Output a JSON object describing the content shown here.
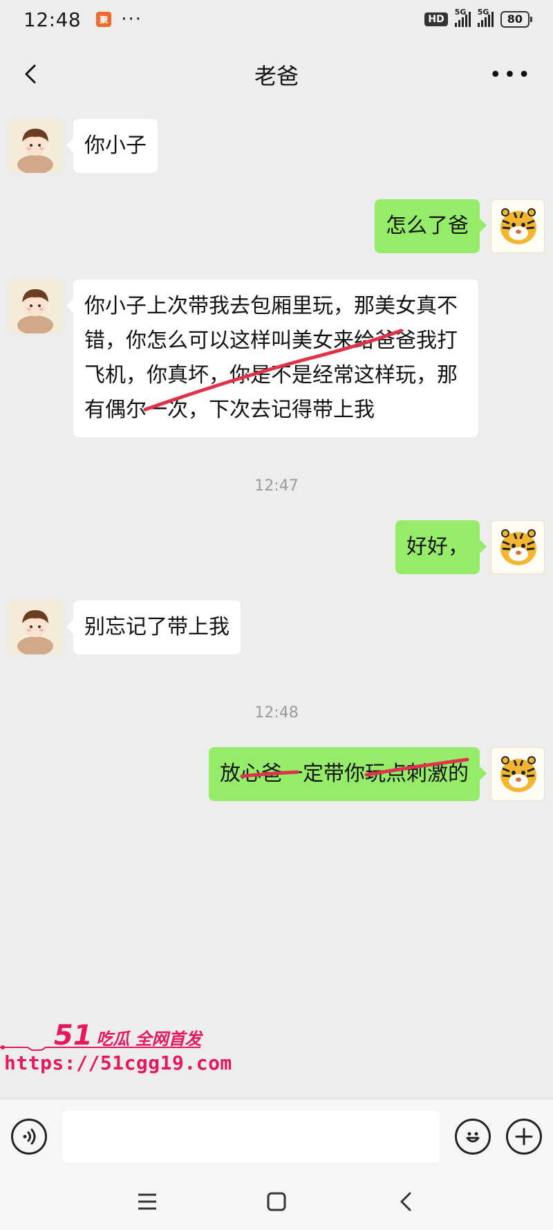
{
  "status_bar": {
    "time": "12:48",
    "app_icon_label": "聚",
    "dots": "···",
    "hd_label": "HD",
    "network_1": "5G",
    "network_2": "5G",
    "battery": "80"
  },
  "header": {
    "title": "老爸"
  },
  "messages": [
    {
      "side": "left",
      "text": "你小子"
    },
    {
      "side": "right",
      "text": "怎么了爸"
    },
    {
      "side": "left",
      "text": "你小子上次带我去包厢里玩，那美女真不错，你怎么可以这样叫美女来给爸爸我打飞机，你真坏，你是不是经常这样玩，那有偶尔一次，下次去记得带上我"
    },
    {
      "side": "right",
      "text": "好好，"
    },
    {
      "side": "left",
      "text": "别忘记了带上我"
    },
    {
      "side": "right",
      "text": "放心爸一定带你玩点刺激的"
    }
  ],
  "timestamps": [
    "12:47",
    "12:48"
  ],
  "watermark": {
    "brand_number": "51",
    "brand_text": "吃瓜 全网首发",
    "url": "https://51cgg19.com",
    "color": "#e8175d"
  },
  "input": {
    "value": "",
    "placeholder": ""
  },
  "colors": {
    "bubble_self": "#95ec69",
    "bubble_other": "#ffffff",
    "background": "#ededed",
    "redline": "#e0334a"
  },
  "icons": {
    "back": "chevron-left-icon",
    "more": "more-dots-icon",
    "voice": "voice-icon",
    "emoji": "emoji-icon",
    "plus": "plus-icon",
    "nav_menu": "menu-icon",
    "nav_home": "home-icon",
    "nav_back": "back-icon"
  }
}
